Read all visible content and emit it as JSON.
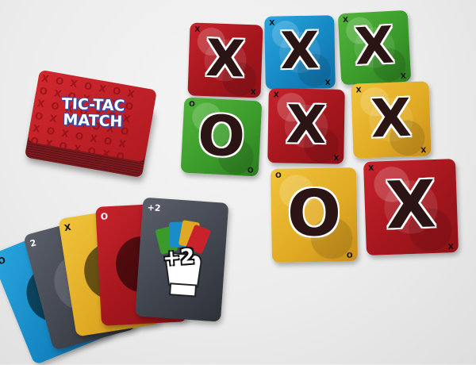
{
  "deck": {
    "logo_line1": "TIC-TAC",
    "logo_line2": "MATCH",
    "pattern": "XOXOXOXOXOXOXOXOXOXOXOXOXOXOXOXOXOXOXOXOXOXOXOXOXO"
  },
  "grid": [
    {
      "symbol": "X",
      "color": "#b01a21"
    },
    {
      "symbol": "X",
      "color": "#1a8cc8"
    },
    {
      "symbol": "X",
      "color": "#3e9e2c"
    },
    {
      "symbol": "O",
      "color": "#3e9e2c"
    },
    {
      "symbol": "X",
      "color": "#b01a21"
    },
    {
      "symbol": "X",
      "color": "#e0a923"
    },
    {
      "symbol": "O",
      "color": "#e0a923"
    },
    {
      "symbol": "X",
      "color": "#b01a21"
    }
  ],
  "hand": [
    {
      "corner": "O",
      "color": "#1a8cc8"
    },
    {
      "corner": "2",
      "color": "#3f434c"
    },
    {
      "corner": "X",
      "color": "#e0a923"
    },
    {
      "corner": "O",
      "color": "#b01a21"
    },
    {
      "corner": "+2",
      "color": "#3f434c",
      "label": "+2"
    }
  ]
}
